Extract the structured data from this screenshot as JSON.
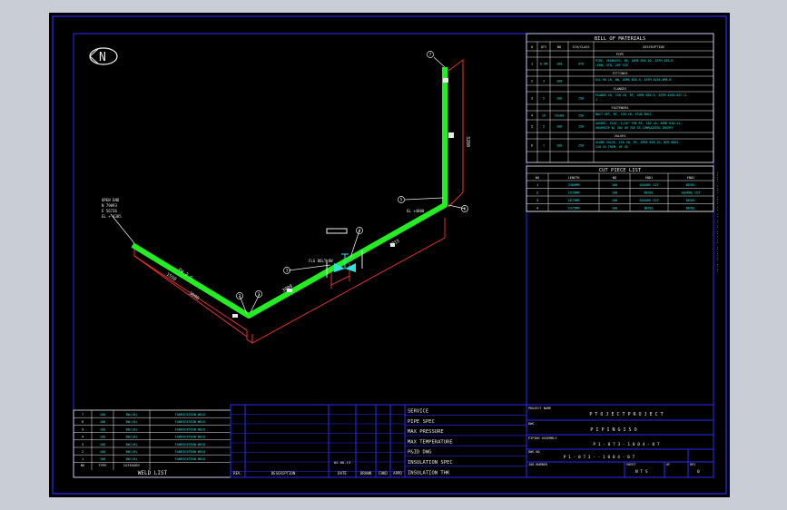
{
  "north": "N",
  "bom": {
    "title": "BILL OF MATERIALS",
    "headers": [
      "#",
      "QTY",
      "ND",
      "SCH/CLASS",
      "DESCRIPTION"
    ],
    "sections": [
      {
        "label": "PIPE",
        "rows": [
          {
            "n": "1",
            "qty": "8.9M",
            "nd": "100",
            "sch": "STD",
            "desc": [
              "PIPE, SEAMLESS, BE, ASME B36.10, ASTM A53-B",
              "(ERW) STD, 20F STD"
            ]
          }
        ]
      },
      {
        "label": "FITTINGS",
        "rows": [
          {
            "n": "2",
            "qty": "3",
            "nd": "100",
            "sch": "",
            "desc": [
              "ELL 90 LR, BW, ASME B16.9, ASTM A234-WPB-B"
            ]
          }
        ]
      },
      {
        "label": "FLANGES",
        "rows": [
          {
            "n": "3",
            "qty": "5",
            "nd": "100",
            "sch": "150",
            "desc": [
              "FLANGE SO, 150 LB, RF, ASME B16.5, ASTM A105-A27 CL",
              "1"
            ]
          }
        ]
      },
      {
        "label": "FASTENERS",
        "rows": [
          {
            "n": "4",
            "qty": "16",
            "nd": "16x80",
            "sch": "150",
            "desc": [
              "BOLT SET, RF, 150 LB, STUD BOLT"
            ]
          },
          {
            "n": "5",
            "qty": "5",
            "nd": "100",
            "sch": "150",
            "desc": [
              "GASKET, FLAT, 1/16\" THK RF, 150 LB, ASME B16.21,",
              "GRAPHITE W/ 304 OR 316 SS CORRUGATED INSERT"
            ]
          }
        ]
      },
      {
        "label": "VALVES",
        "rows": [
          {
            "n": "6",
            "qty": "1",
            "nd": "100",
            "sch": "150",
            "desc": [
              "GLOBE VALVE, 150 LB, RF, ASME B16.10, WCB BODY",
              "316 SS TRIM, HF SE"
            ]
          }
        ]
      }
    ]
  },
  "cut": {
    "title": "CUT PIECE LIST",
    "headers": [
      "NO",
      "LENGTH",
      "ND",
      "END1",
      "END2"
    ],
    "rows": [
      [
        "1",
        "3380MM",
        "100",
        "SQUARE CUT",
        "BEVEL"
      ],
      [
        "2",
        "2970MM",
        "100",
        "BEVEL",
        "SQUARE CUT"
      ],
      [
        "3",
        "1075MM",
        "100",
        "SQUARE CUT",
        "BEVEL"
      ],
      [
        "4",
        "2475MM",
        "100",
        "BEVEL",
        "BEVEL"
      ]
    ]
  },
  "weld": {
    "title": "WELD LIST",
    "headers": [
      "NO",
      "TYPE",
      "CATEGORY"
    ],
    "rows": [
      [
        "7",
        "100",
        "BW(LB)",
        "FABRICATION WELD"
      ],
      [
        "6",
        "100",
        "BW(LB)",
        "FABRICATION WELD"
      ],
      [
        "5",
        "100",
        "BW(LB)",
        "FABRICATION WELD"
      ],
      [
        "4",
        "100",
        "BW(LB)",
        "FABRICATION WELD"
      ],
      [
        "3",
        "100",
        "BW(LB)",
        "FABRICATION WELD"
      ],
      [
        "2",
        "100",
        "BW(LB)",
        "FABRICATION WELD"
      ],
      [
        "1",
        "100",
        "BW(LB)",
        "FABRICATION WELD"
      ]
    ]
  },
  "revision": {
    "headers": [
      "REV.",
      "DESCRIPTION",
      "DATE",
      "DRAWN",
      "CHKD",
      "APPD"
    ],
    "note": "02-06-13"
  },
  "service": {
    "labels": [
      "SERVICE",
      "PIPE SPEC",
      "MAX PRESSURE",
      "MAX TEMPERATURE",
      "P&ID DWG",
      "INSULATION SPEC",
      "INSULATION THK"
    ]
  },
  "title_block": {
    "project_label": "PROJECT NAME",
    "project_value": "P T O J E C T   P R O J E C T",
    "dwg_label": "DWG",
    "dwg_value": "P I P I N G   I S O",
    "assy_label": "PIPING ASSEMBLY",
    "assy_value": "P 1 - 0 7 3 - 1 0 0 4 - 0 7",
    "dwgno_label": "DWG NO",
    "dwgno_value": "P 1 - 0 7 3 - - 1 0 0 4 - 0 7",
    "jobno_label": "JOB NUMBER",
    "sheet_label": "SHEET",
    "sheet_value": "N T S",
    "of_label": "OF",
    "rev_label": "REV",
    "rev_value": "0"
  },
  "annotations": {
    "start_label": [
      "OPEN END",
      "N 79093",
      "E 56736",
      "EL + 4385"
    ],
    "elev1": "EL +4000",
    "fw_label": "FW 2 G",
    "bnd_label": "FLG BOLT BW",
    "dim1": "3000",
    "dim2": "3015",
    "dim3": "3280",
    "dim4": "1550",
    "dim5": "3000",
    "callouts": [
      "1",
      "2",
      "3",
      "4",
      "5",
      "6",
      "7"
    ]
  },
  "colors": {
    "pipe": "#22ee22",
    "frame": "#2a2aff",
    "dim": "#ff3030",
    "text": "#e8e8e8",
    "cyan": "#2fe0e0"
  }
}
